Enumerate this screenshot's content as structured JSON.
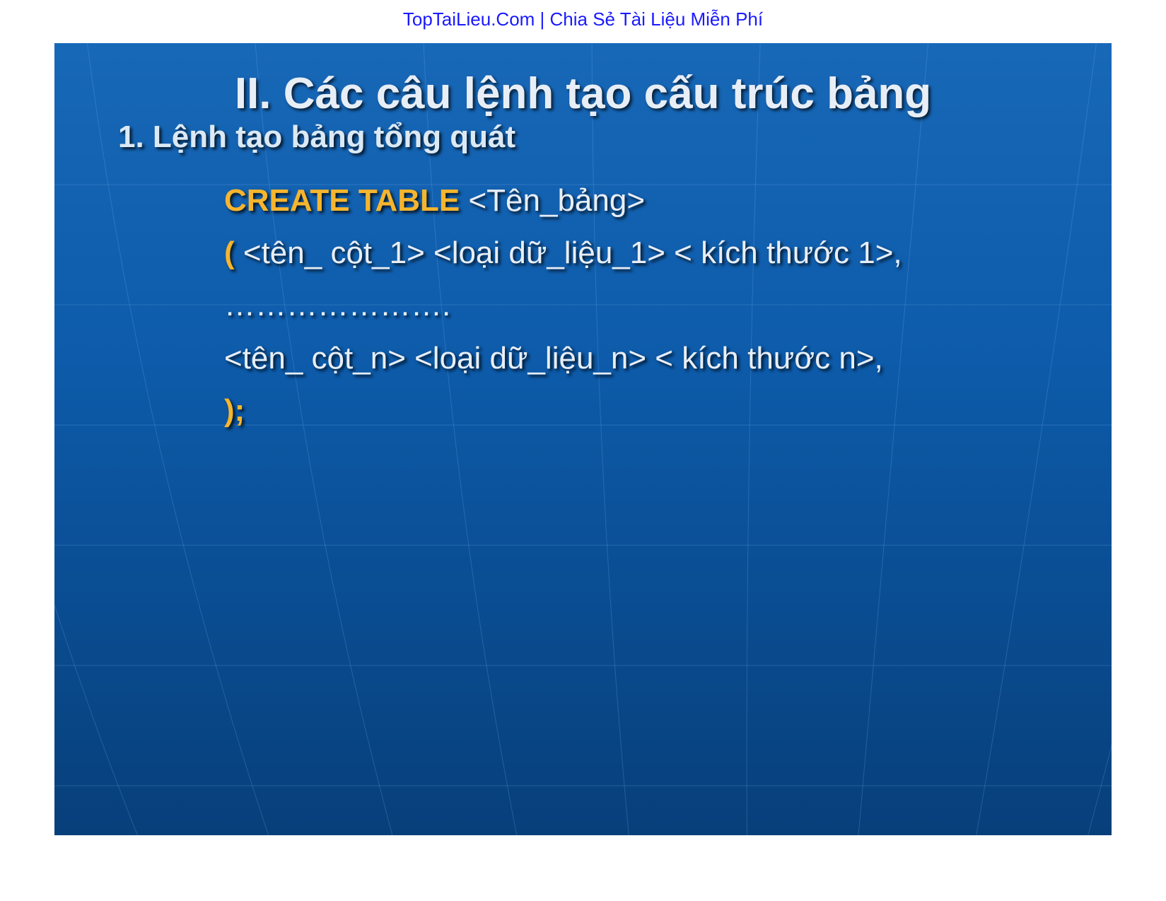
{
  "header": {
    "text": "TopTaiLieu.Com | Chia Sẻ Tài Liệu Miễn Phí"
  },
  "slide": {
    "title": "II. Các câu lệnh tạo cấu trúc bảng",
    "subtitle": "1.  Lệnh tạo bảng tổng quát",
    "lines": {
      "l1_kw": "CREATE TABLE",
      "l1_rest": " <Tên_bảng>",
      "l2_kw": "(",
      "l2_rest": " <tên_ cột_1>   <loại dữ_liệu_1>   < kích thước 1>,",
      "l3": "………………….",
      "l4": "<tên_ cột_n>   <loại dữ_liệu_n>   < kích thước n>,",
      "l5_kw": ");"
    }
  }
}
